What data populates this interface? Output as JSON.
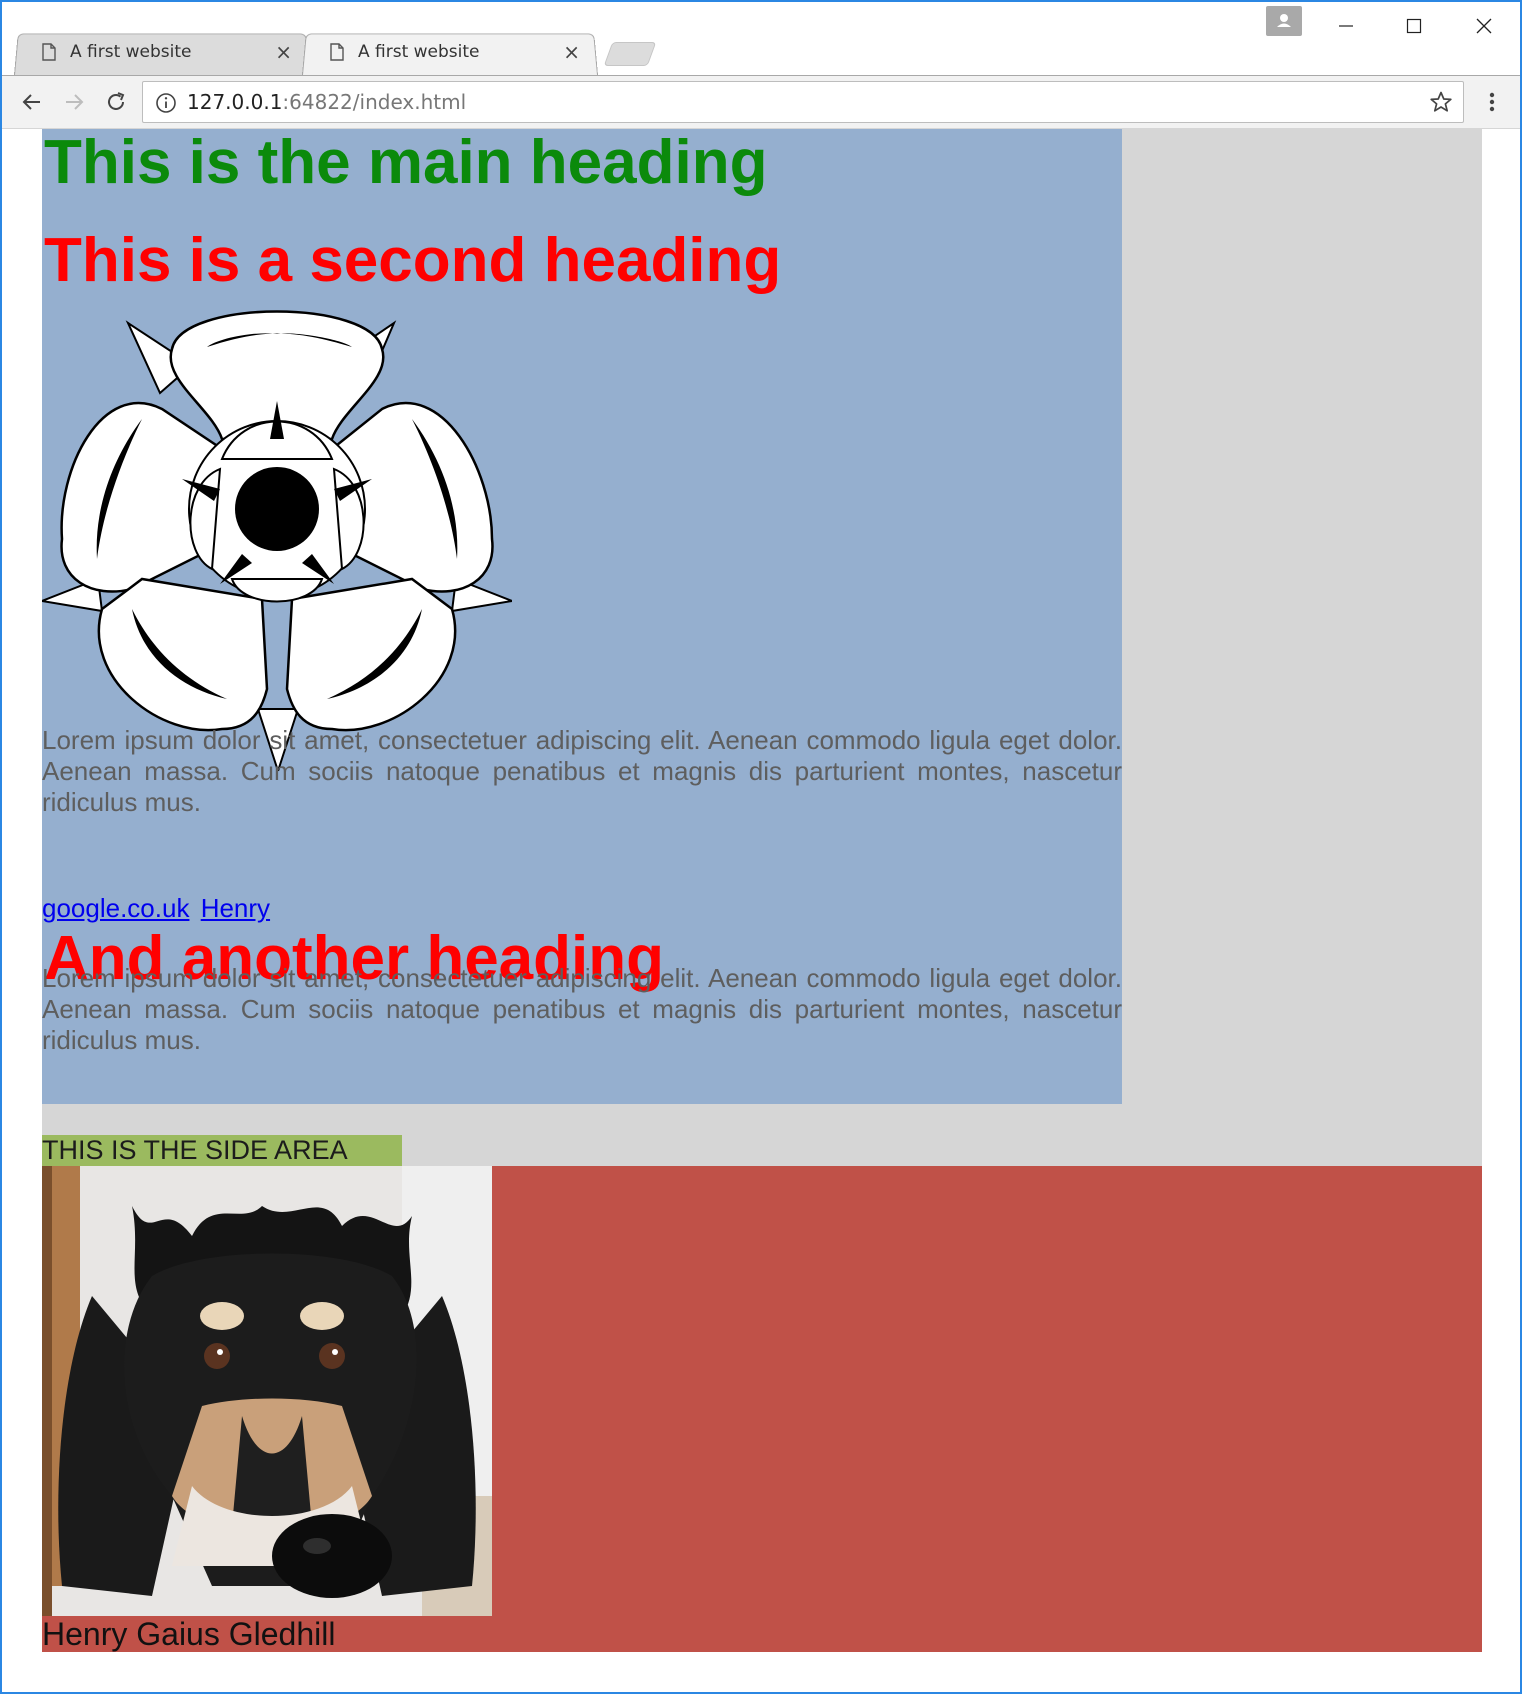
{
  "browser": {
    "tabs": [
      {
        "title": "A first website",
        "active": false,
        "icon": "page-icon"
      },
      {
        "title": "A first website",
        "active": true,
        "icon": "page-icon"
      }
    ],
    "close_glyph": "×",
    "address": {
      "host": "127.0.0.1",
      "path": ":64822/index.html"
    },
    "icons": {
      "back": "arrow-left-icon",
      "forward": "arrow-right-icon",
      "reload": "reload-icon",
      "info": "info-icon",
      "bookmark": "star-icon",
      "menu": "kebab-menu-icon",
      "profile": "profile-icon",
      "minimize": "minimize-icon",
      "maximize": "maximize-icon",
      "close": "close-icon"
    },
    "colors": {
      "frame": "#2b87e3"
    }
  },
  "page": {
    "main_heading": "This is the main heading",
    "second_heading": "This is a second heading",
    "image_rose": "tudor-rose-image",
    "paragraph_1": "Lorem ipsum dolor sit amet, consectetuer adipiscing elit. Aenean commodo ligula eget dolor. Aenean massa. Cum sociis natoque penatibus et magnis dis parturient montes, nascetur ridiculus mus.",
    "links": [
      "google.co.uk",
      "Henry"
    ],
    "third_heading": "And another heading",
    "paragraph_2": "Lorem ipsum dolor sit amet, consectetuer adipiscing elit. Aenean commodo ligula eget dolor. Aenean massa. Cum sociis natoque penatibus et magnis dis parturient montes, nascetur ridiculus mus.",
    "side_label": "THIS IS THE SIDE AREA",
    "image_dog": "dog-photo",
    "caption": "Henry Gaius Gledhill",
    "colors": {
      "container": "#d6d6d6",
      "main": "#95afcf",
      "heading_main": "#0b8a0b",
      "heading_other": "#ff0000",
      "side": "#9bba5f",
      "footer": "#c05148"
    }
  }
}
